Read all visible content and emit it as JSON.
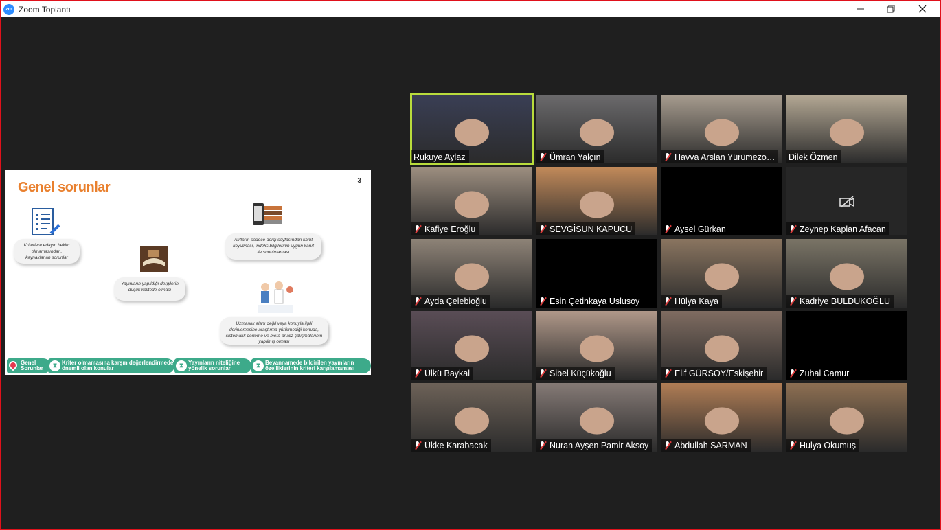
{
  "window": {
    "title": "Zoom Toplantı",
    "logo_text": "zm",
    "controls": {
      "minimize": "—",
      "restore": "❐",
      "close": "✕"
    }
  },
  "slide": {
    "title": "Genel sorunlar",
    "page_number": "3",
    "bubbles": [
      "Kriterlere edayın hekim olmamasından, kaynaklanan sorunlar",
      "Atıfların sadece dergi sayfasından kanıt koyulması, indeks bilgilerinin uygun kanıt ile sunulmaması",
      "Yayınların yapıldığı dergilerin düşük kalitede olması",
      "Uzmanlık alanı değil veya konuyla ilgili derinlemesine araştırma yürütmediği konuda, sistematik derleme ve meta-analiz çalışmalarının yapılmış olması"
    ],
    "footer": [
      "Genel Sorunlar",
      "Kriter olmamasına karşın değerlendirmede önemli olan konular",
      "Yayınların niteliğine yönelik sorunlar",
      "Beyannamede bildirilen yayınların özelliklerinin kriteri karşılamaması"
    ]
  },
  "participants": [
    {
      "name": "Rukuye Aylaz",
      "muted": false,
      "video": true,
      "bg": "#3a3f55"
    },
    {
      "name": "Ümran Yalçın",
      "muted": true,
      "video": true,
      "bg": "#6b6a6c"
    },
    {
      "name": "Havva Arslan Yürümezo…",
      "muted": true,
      "video": true,
      "bg": "#a79c8f"
    },
    {
      "name": "Dilek Özmen",
      "muted": false,
      "video": true,
      "bg": "#b4a894"
    },
    {
      "name": "Kafiye Eroğlu",
      "muted": true,
      "video": true,
      "bg": "#9d8f80"
    },
    {
      "name": "SEVGİSUN KAPUCU",
      "muted": true,
      "video": true,
      "bg": "#c28a5a"
    },
    {
      "name": "Aysel Gürkan",
      "muted": true,
      "video": false,
      "bg": "#000000"
    },
    {
      "name": "Zeynep Kaplan Afacan",
      "muted": true,
      "video": false,
      "bg": "#262626"
    },
    {
      "name": "Ayda Çelebioğlu",
      "muted": true,
      "video": true,
      "bg": "#8e8377"
    },
    {
      "name": "Esin Çetinkaya Uslusoy",
      "muted": true,
      "video": false,
      "bg": "#000000"
    },
    {
      "name": "Hülya Kaya",
      "muted": true,
      "video": true,
      "bg": "#8a7560"
    },
    {
      "name": "Kadriye BULDUKOĞLU",
      "muted": true,
      "video": true,
      "bg": "#7a7466"
    },
    {
      "name": "Ülkü Baykal",
      "muted": true,
      "video": true,
      "bg": "#5a4d56"
    },
    {
      "name": "Sibel Küçükoğlu",
      "muted": true,
      "video": true,
      "bg": "#b09889"
    },
    {
      "name": "Elif GÜRSOY/Eskişehir",
      "muted": true,
      "video": true,
      "bg": "#7f6c61"
    },
    {
      "name": "Zuhal Camur",
      "muted": true,
      "video": false,
      "bg": "#000000"
    },
    {
      "name": "Ükke Karabacak",
      "muted": true,
      "video": true,
      "bg": "#6d6258"
    },
    {
      "name": "Nuran Ayşen Pamir Aksoy",
      "muted": true,
      "video": true,
      "bg": "#857a76"
    },
    {
      "name": "Abdullah SARMAN",
      "muted": true,
      "video": true,
      "bg": "#b07d55"
    },
    {
      "name": "Hulya Okumuş",
      "muted": true,
      "video": true,
      "bg": "#8d6f52"
    }
  ],
  "colors": {
    "window_border": "#e0111b",
    "active_speaker": "#b9dc3c",
    "slide_title": "#e9802e",
    "slide_footer": "#3daa8a",
    "mute_slash": "#e23a3a"
  },
  "icons": [
    "zoom-logo-icon",
    "minimize-icon",
    "restore-icon",
    "close-icon",
    "muted-mic-icon",
    "video-off-icon",
    "location-pin-icon"
  ]
}
